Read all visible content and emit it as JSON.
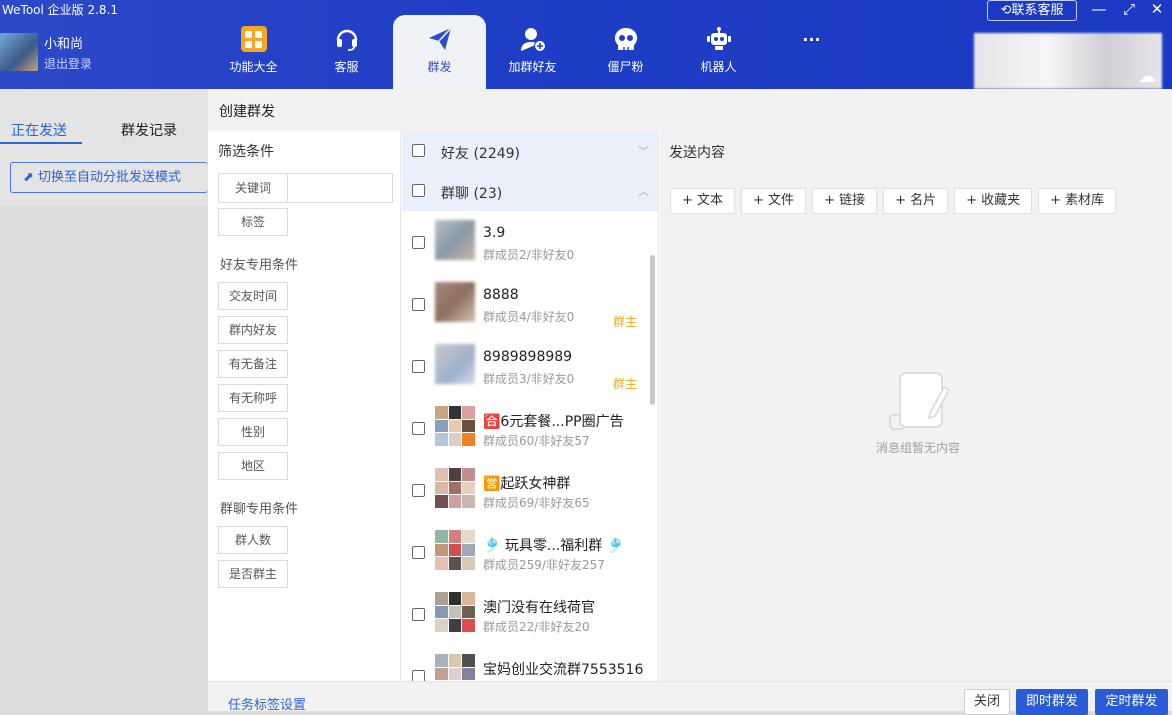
{
  "app": {
    "title": "WeTool 企业版 2.8.1"
  },
  "user": {
    "name": "小和尚",
    "logout": "退出登录"
  },
  "nav": {
    "items": [
      {
        "label": "功能大全"
      },
      {
        "label": "客服"
      },
      {
        "label": "群发"
      },
      {
        "label": "加群好友"
      },
      {
        "label": "僵尸粉"
      },
      {
        "label": "机器人"
      },
      {
        "label": "···"
      }
    ],
    "active": "群发"
  },
  "header": {
    "contact": "联系客服"
  },
  "left": {
    "tabs": [
      "正在发送",
      "群发记录"
    ],
    "switch_button": "切换至自动分批发送模式"
  },
  "dialog": {
    "title": "创建群发",
    "filter": {
      "title": "筛选条件",
      "keyword_label": "关键词",
      "tag_label": "标签",
      "friend_section": "好友专用条件",
      "friend_chips": [
        "交友时间",
        "群内好友",
        "有无备注",
        "有无称呼",
        "性别",
        "地区"
      ],
      "group_section": "群聊专用条件",
      "group_chips": [
        "群人数",
        "是否群主"
      ]
    },
    "friends_group": {
      "label": "好友",
      "count": "(2249)"
    },
    "chats_group": {
      "label": "群聊",
      "count": "(23)"
    },
    "chats": [
      {
        "name": "3.9",
        "sub": "群成员2/非好友0",
        "owner": ""
      },
      {
        "name": "8888",
        "sub": "群成员4/非好友0",
        "owner": "群主"
      },
      {
        "name": "8989898989",
        "sub": "群成员3/非好友0",
        "owner": "群主"
      },
      {
        "name": "🈴6元套餐...PP圈广告",
        "sub": "群成员60/非好友57",
        "owner": ""
      },
      {
        "name": "🈺起跃女神群",
        "sub": "群成员69/非好友65",
        "owner": ""
      },
      {
        "name": "🎐 玩具零...福利群 🎐",
        "sub": "群成员259/非好友257",
        "owner": ""
      },
      {
        "name": "澳门没有在线荷官",
        "sub": "群成员22/非好友20",
        "owner": ""
      },
      {
        "name": "宝妈创业交流群7553516",
        "sub": "",
        "owner": ""
      }
    ],
    "send": {
      "title": "发送内容",
      "tools": [
        "+ 文本",
        "+ 文件",
        "+ 链接",
        "+ 名片",
        "+ 收藏夹",
        "+ 素材库"
      ],
      "empty": "消息组暂无内容"
    },
    "footer": {
      "tag_settings": "任务标签设置",
      "close": "关闭",
      "send_now": "即时群发",
      "send_timed": "定时群发"
    }
  },
  "colors": {
    "accent": "#2a5bd7",
    "titlebar": "#1f3ec6",
    "owner": "#f5a623"
  }
}
